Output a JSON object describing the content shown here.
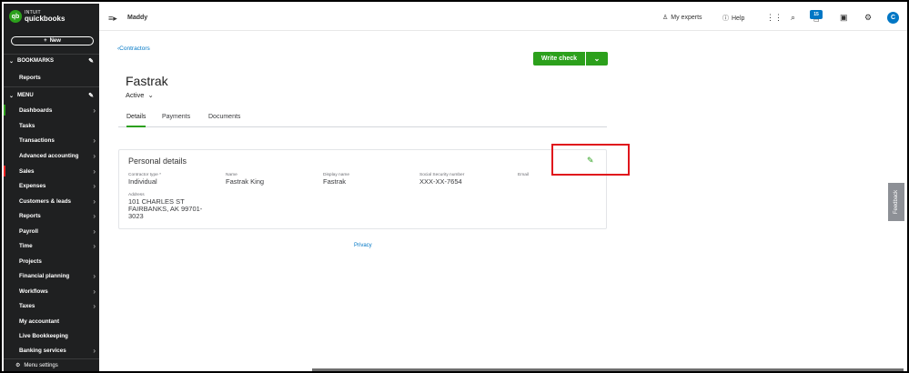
{
  "sidebar": {
    "logo_line1": "INTUIT",
    "logo_line2": "quickbooks",
    "logo_mark": "qb",
    "new_label": "New",
    "bookmarks_label": "BOOKMARKS",
    "bookmarks_items": [
      "Reports"
    ],
    "menu_label": "MENU",
    "items": [
      {
        "label": "Dashboards",
        "chevron": true
      },
      {
        "label": "Tasks",
        "chevron": false
      },
      {
        "label": "Transactions",
        "chevron": true
      },
      {
        "label": "Advanced accounting",
        "chevron": true
      },
      {
        "label": "Sales",
        "chevron": true
      },
      {
        "label": "Expenses",
        "chevron": true
      },
      {
        "label": "Customers & leads",
        "chevron": true
      },
      {
        "label": "Reports",
        "chevron": true
      },
      {
        "label": "Payroll",
        "chevron": true
      },
      {
        "label": "Time",
        "chevron": true
      },
      {
        "label": "Projects",
        "chevron": false
      },
      {
        "label": "Financial planning",
        "chevron": true
      },
      {
        "label": "Workflows",
        "chevron": true
      },
      {
        "label": "Taxes",
        "chevron": true
      },
      {
        "label": "My accountant",
        "chevron": false
      },
      {
        "label": "Live Bookkeeping",
        "chevron": false
      },
      {
        "label": "Banking services",
        "chevron": true
      }
    ],
    "menu_settings_label": "Menu settings"
  },
  "topbar": {
    "company": "Maddy",
    "my_experts": "My experts",
    "help": "Help",
    "notification_count": "15",
    "avatar_initial": "C"
  },
  "page": {
    "breadcrumb": "Contractors",
    "write_check_label": "Write check",
    "title": "Fastrak",
    "status": "Active",
    "tabs": [
      "Details",
      "Payments",
      "Documents"
    ],
    "active_tab": "Details"
  },
  "card": {
    "title": "Personal details",
    "fields": {
      "contractor_type_label": "Contractor type *",
      "contractor_type_value": "Individual",
      "name_label": "Name",
      "name_value": "Fastrak King",
      "display_name_label": "Display name",
      "display_name_value": "Fastrak",
      "ssn_label": "Social Security number",
      "ssn_value": "XXX-XX-7654",
      "email_label": "Email",
      "address_label": "Address",
      "address_line1": "101 CHARLES ST",
      "address_line2": "FAIRBANKS, AK 99701-",
      "address_line3": "3023"
    }
  },
  "footer": {
    "privacy": "Privacy",
    "feedback": "Feedback"
  },
  "colors": {
    "brand_green": "#2ca01c",
    "link_blue": "#0077c5",
    "sidebar_bg": "#1f2021",
    "highlight_red": "#e0151c"
  }
}
